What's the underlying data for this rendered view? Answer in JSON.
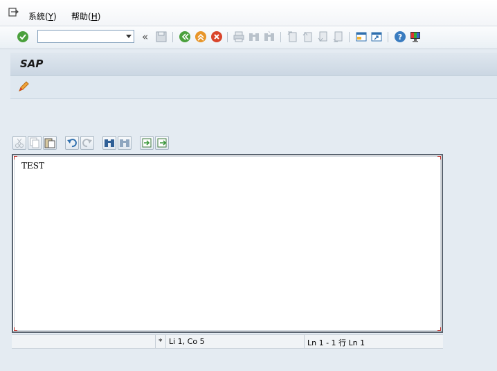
{
  "menubar": {
    "items": [
      {
        "label": "系統(",
        "accel": "Y",
        "tail": ")"
      },
      {
        "label": "帮助(",
        "accel": "H",
        "tail": ")"
      }
    ]
  },
  "toolbar": {
    "command_field_value": "",
    "icons": [
      "enter-icon",
      "save-icon",
      "back-icon",
      "exit-icon",
      "cancel-icon",
      "print-icon",
      "find-icon",
      "find-next-icon",
      "first-page-icon",
      "previous-page-icon",
      "next-page-icon",
      "last-page-icon",
      "create-session-icon",
      "shortcut-icon",
      "help-icon",
      "layout-menu-icon"
    ]
  },
  "screen": {
    "title": "SAP"
  },
  "editor": {
    "content": "TEST",
    "toolbar_icons": [
      "cut-icon",
      "copy-icon",
      "paste-icon",
      "undo-icon",
      "redo-icon",
      "find-icon",
      "find-next-icon",
      "import-icon",
      "export-icon"
    ]
  },
  "statusbar": {
    "modified": "*",
    "cursor": "Li 1, Co 5",
    "lines": "Ln 1 - 1 行 Ln 1"
  },
  "colors": {
    "background": "#e4ebf2",
    "title_bar": "#cbd7e3",
    "accent_green": "#4aa03c",
    "accent_orange": "#e8962a",
    "accent_red": "#d9452b",
    "editor_corner": "#c0302a"
  }
}
